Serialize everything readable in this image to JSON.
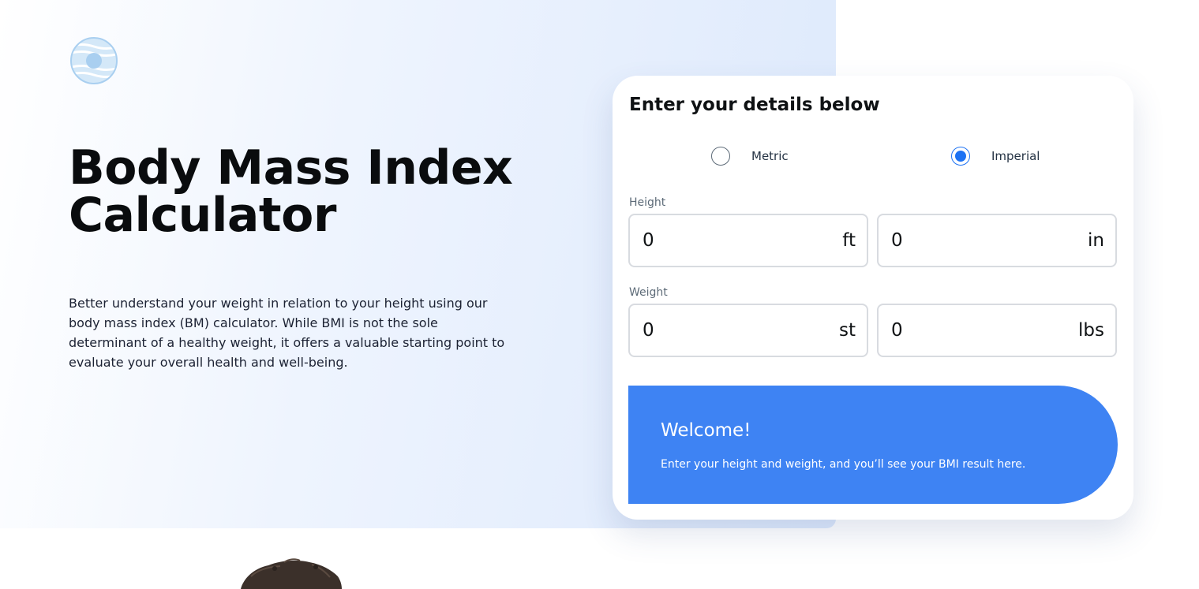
{
  "colors": {
    "accent": "#3e83f3",
    "radio_selected": "#1d72f3",
    "logo": "#a9cff0"
  },
  "header": {
    "logo_icon": "striped-circle-logo-icon",
    "title": "Body Mass Index Calculator",
    "intro": "Better understand your weight in relation to your height using our body mass index (BM) calculator. While BMI is not the sole determinant of a healthy weight, it offers a valuable starting point to evaluate your overall health and well-being."
  },
  "form": {
    "title": "Enter your details below",
    "units": [
      {
        "label": "Metric",
        "selected": false
      },
      {
        "label": "Imperial",
        "selected": true
      }
    ],
    "height": {
      "label": "Height",
      "ft_value": "0",
      "ft_unit": "ft",
      "in_value": "0",
      "in_unit": "in"
    },
    "weight": {
      "label": "Weight",
      "st_value": "0",
      "st_unit": "st",
      "lbs_value": "0",
      "lbs_unit": "lbs"
    },
    "result": {
      "heading": "Welcome!",
      "text": "Enter your height and weight, and you’ll see your BMI result here."
    }
  }
}
